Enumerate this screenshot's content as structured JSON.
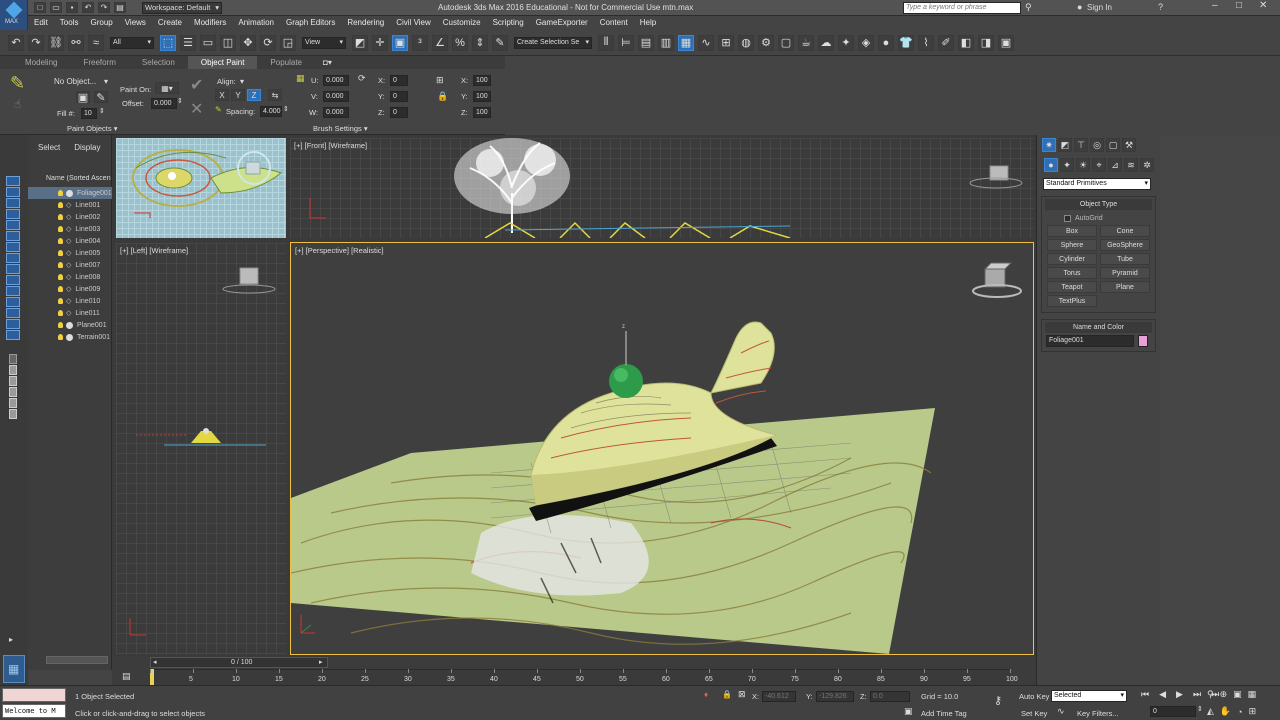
{
  "titlebar": {
    "workspace": "Workspace: Default",
    "title": "Autodesk 3ds Max 2016 Educational - Not for Commercial Use    mtn.max",
    "search_placeholder": "Type a keyword or phrase",
    "sign_in": "Sign In",
    "app_badge": "MAX"
  },
  "menus": [
    "Edit",
    "Tools",
    "Group",
    "Views",
    "Create",
    "Modifiers",
    "Animation",
    "Graph Editors",
    "Rendering",
    "Civil View",
    "Customize",
    "Scripting",
    "GameExporter",
    "Content",
    "Help"
  ],
  "toolbar": {
    "selection_filter": "All",
    "ref_coord": "View",
    "named_selection": "Create Selection Se"
  },
  "ribbon": {
    "tabs": [
      "Modeling",
      "Freeform",
      "Selection",
      "Object Paint",
      "Populate"
    ],
    "active_tab": "Object Paint",
    "no_object": "No Object...",
    "fill_label": "Fill #:",
    "fill_value": "10",
    "paint_on": "Paint On:",
    "offset_label": "Offset:",
    "offset_value": "0.000",
    "align_label": "Align:",
    "axes": [
      "X",
      "Y",
      "Z"
    ],
    "spacing_label": "Spacing:",
    "spacing_value": "4.000",
    "u_label": "U:",
    "u_value": "0.000",
    "v_label": "V:",
    "v_value": "0.000",
    "w_label": "W:",
    "w_value": "0.000",
    "rx_label": "X:",
    "rx_value": "0",
    "ry_label": "Y:",
    "ry_value": "0",
    "rz_label": "Z:",
    "rz_value": "0",
    "sx_label": "X:",
    "sx_value": "100",
    "sy_label": "Y:",
    "sy_value": "100",
    "sz_label": "Z:",
    "sz_value": "100",
    "paint_objects": "Paint Objects",
    "brush_settings": "Brush Settings"
  },
  "explorer": {
    "tabs": [
      "Select",
      "Display"
    ],
    "header": "Name (Sorted Ascen",
    "items": [
      "Foliage001",
      "Line001",
      "Line002",
      "Line003",
      "Line004",
      "Line005",
      "Line007",
      "Line008",
      "Line009",
      "Line010",
      "Line011",
      "Plane001",
      "Terrain001"
    ]
  },
  "viewports": {
    "top": "",
    "front": "[+] [Front] [Wireframe]",
    "left": "[+] [Left] [Wireframe]",
    "perspective": "[+] [Perspective] [Realistic]"
  },
  "cmdpanel": {
    "primitive_type": "Standard Primitives",
    "object_type_header": "Object Type",
    "autogrid": "AutoGrid",
    "buttons": [
      "Box",
      "Cone",
      "Sphere",
      "GeoSphere",
      "Cylinder",
      "Tube",
      "Torus",
      "Pyramid",
      "Teapot",
      "Plane",
      "TextPlus"
    ],
    "name_color_header": "Name and Color",
    "object_name": "Foliage001",
    "object_color": "#e8a0d8"
  },
  "timeline": {
    "frame_counter": "0 / 100",
    "ticks": [
      "0",
      "5",
      "10",
      "15",
      "20",
      "25",
      "30",
      "35",
      "40",
      "45",
      "50",
      "55",
      "60",
      "65",
      "70",
      "75",
      "80",
      "85",
      "90",
      "95",
      "100"
    ]
  },
  "status": {
    "maxscript": "Welcome to M",
    "selected": "1 Object Selected",
    "prompt": "Click or click-and-drag to select objects",
    "x_label": "X:",
    "x_value": "-40.612",
    "y_label": "Y:",
    "y_value": "-129.826",
    "z_label": "Z:",
    "z_value": "0.0",
    "grid": "Grid = 10.0",
    "add_time_tag": "Add Time Tag",
    "auto_key": "Auto Key",
    "key_mode": "Selected",
    "set_key": "Set Key",
    "key_filters": "Key Filters...",
    "frame": "0"
  }
}
